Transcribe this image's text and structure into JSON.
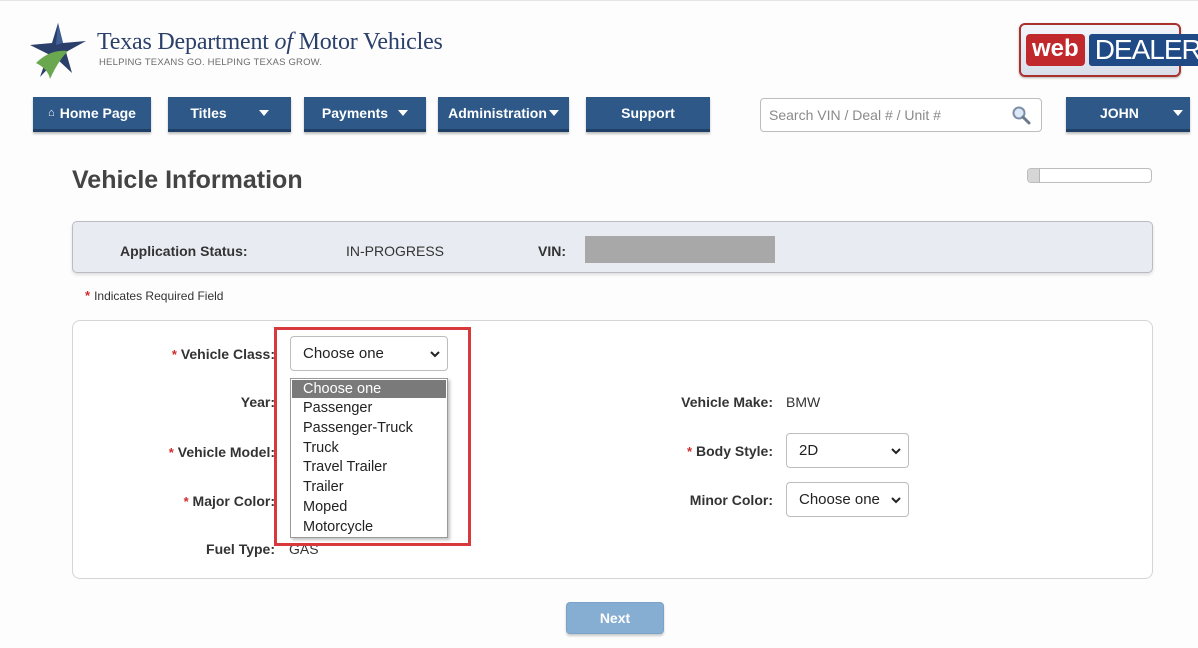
{
  "header": {
    "title_pre": "Texas Department ",
    "title_of": "of",
    "title_post": " Motor Vehicles",
    "tagline": "HELPING TEXANS GO. HELPING TEXAS GROW.",
    "badge_web": "web",
    "badge_dealer": "DEALER"
  },
  "nav": {
    "home": "Home Page",
    "titles": "Titles",
    "payments": "Payments",
    "administration": "Administration",
    "support": "Support",
    "search_placeholder": "Search VIN / Deal # / Unit #",
    "user": "JOHN"
  },
  "page": {
    "title": "Vehicle Information",
    "progress_fraction": 0.1
  },
  "status": {
    "app_status_label": "Application Status:",
    "app_status_value": "IN-PROGRESS",
    "vin_label": "VIN:"
  },
  "required_note": "Indicates Required Field",
  "required_mark": "*",
  "form": {
    "vehicle_class_label": "Vehicle Class:",
    "vehicle_class_value": "Choose one",
    "vehicle_class_options": [
      "Choose one",
      "Passenger",
      "Passenger-Truck",
      "Truck",
      "Travel Trailer",
      "Trailer",
      "Moped",
      "Motorcycle"
    ],
    "year_label": "Year:",
    "vehicle_make_label": "Vehicle Make:",
    "vehicle_make_value": "BMW",
    "vehicle_model_label": "Vehicle Model:",
    "body_style_label": "Body Style:",
    "body_style_value": "2D",
    "major_color_label": "Major Color:",
    "minor_color_label": "Minor Color:",
    "minor_color_value": "Choose one",
    "fuel_type_label": "Fuel Type:",
    "fuel_type_value": "GAS"
  },
  "actions": {
    "next": "Next"
  },
  "colors": {
    "nav_blue": "#2d5888",
    "required_red": "#d02b2b",
    "callout_red": "#d8393c"
  }
}
